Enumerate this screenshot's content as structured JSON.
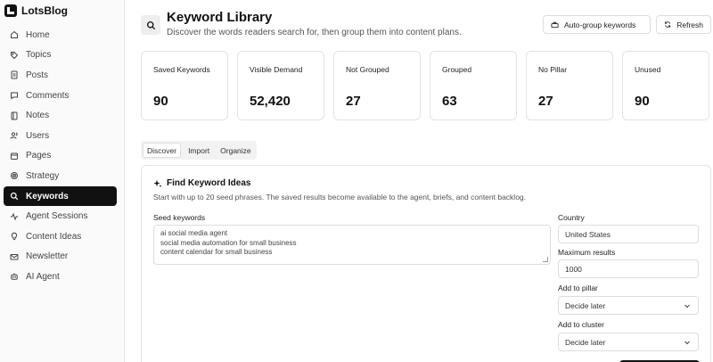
{
  "brand": {
    "name": "LotsBlog"
  },
  "nav": [
    {
      "label": "Home",
      "icon": "home-icon"
    },
    {
      "label": "Topics",
      "icon": "tag-icon"
    },
    {
      "label": "Posts",
      "icon": "document-icon"
    },
    {
      "label": "Comments",
      "icon": "comment-icon"
    },
    {
      "label": "Notes",
      "icon": "note-icon"
    },
    {
      "label": "Users",
      "icon": "users-icon"
    },
    {
      "label": "Pages",
      "icon": "pages-icon"
    },
    {
      "label": "Strategy",
      "icon": "target-icon"
    },
    {
      "label": "Keywords",
      "icon": "search-icon",
      "active": true
    },
    {
      "label": "Agent Sessions",
      "icon": "activity-icon"
    },
    {
      "label": "Content Ideas",
      "icon": "lightbulb-icon"
    },
    {
      "label": "Newsletter",
      "icon": "mail-icon"
    },
    {
      "label": "AI Agent",
      "icon": "bot-icon"
    }
  ],
  "header": {
    "title": "Keyword Library",
    "subtitle": "Discover the words readers search for, then group them into content plans.",
    "autogroup_label": "Auto-group keywords",
    "refresh_label": "Refresh"
  },
  "stats": [
    {
      "label": "Saved Keywords",
      "value": "90"
    },
    {
      "label": "Visible Demand",
      "value": "52,420"
    },
    {
      "label": "Not Grouped",
      "value": "27"
    },
    {
      "label": "Grouped",
      "value": "63"
    },
    {
      "label": "No Pillar",
      "value": "27"
    },
    {
      "label": "Unused",
      "value": "90"
    }
  ],
  "tabs": [
    "Discover",
    "Import",
    "Organize"
  ],
  "discover": {
    "title": "Find Keyword Ideas",
    "description": "Start with up to 20 seed phrases. The saved results become available to the agent, briefs, and content backlog.",
    "seed_label": "Seed keywords",
    "seed_lines": [
      "ai social media agent",
      "social media automation for small business",
      "content calendar for small business"
    ],
    "country_label": "Country",
    "country_value": "United States",
    "max_label": "Maximum results",
    "max_value": "1000",
    "pillar_label": "Add to pillar",
    "pillar_value": "Decide later",
    "cluster_label": "Add to cluster",
    "cluster_value": "Decide later"
  },
  "colors": {
    "active_nav_bg": "#111111",
    "border": "#e3e3e3"
  }
}
